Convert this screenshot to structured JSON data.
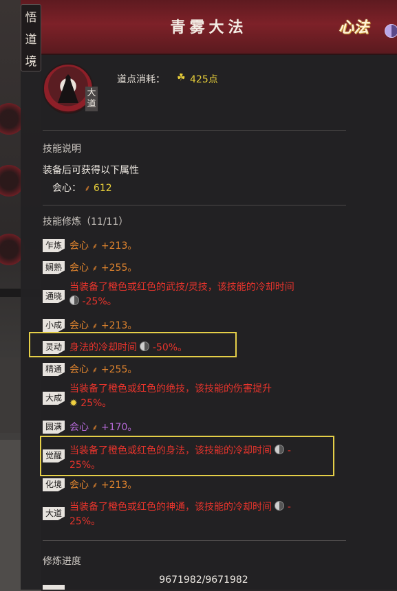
{
  "header": {
    "title": "青雾大法",
    "category_mark": "心法",
    "realm_tag": [
      "悟",
      "道",
      "境"
    ]
  },
  "skill": {
    "tier_tag": [
      "大",
      "道"
    ],
    "cost_label": "道点消耗：",
    "cost_value": "425点"
  },
  "description": {
    "title": "技能说明",
    "intro": "装备后可获得以下属性",
    "stat_label": "会心：",
    "stat_value": "612"
  },
  "training": {
    "title": "技能修炼（11/11）",
    "mods": [
      {
        "badge": "乍炼",
        "stat": "会心",
        "value": "+213。"
      },
      {
        "badge": "娴熟",
        "stat": "会心",
        "value": "+255。"
      },
      {
        "badge": "通晓",
        "text": "当装备了橙色或红色的武技/灵技，该技能的冷却时间",
        "value": "-25%。"
      },
      {
        "badge": "小成",
        "stat": "会心",
        "value": "+213。"
      },
      {
        "badge": "灵动",
        "text": "身法的冷却时间",
        "value": "-50%。"
      },
      {
        "badge": "精通",
        "stat": "会心",
        "value": "+255。"
      },
      {
        "badge": "大成",
        "text": "当装备了橙色或红色的绝技，该技能的伤害提升",
        "value": "25%。"
      },
      {
        "badge": "圆满",
        "stat": "会心",
        "value": "+170。"
      },
      {
        "badge": "觉醒",
        "text": "当装备了橙色或红色的身法，该技能的冷却时间",
        "value": "-",
        "value2": "25%。"
      },
      {
        "badge": "化境",
        "stat": "会心",
        "value": "+213。"
      },
      {
        "badge": "大道",
        "text": "当装备了橙色或红色的神通，该技能的冷却时间",
        "value": "-",
        "value2": "25%。"
      }
    ]
  },
  "progress": {
    "title": "修炼进度",
    "value": "9671982/9671982"
  },
  "colors": {
    "header": "#7d2128",
    "stat_orange": "#e2852e",
    "effect_red": "#e8342c",
    "cost_yellow": "#e8cf3a",
    "max_purple": "#b66ad8",
    "highlight": "#e5cf48"
  }
}
